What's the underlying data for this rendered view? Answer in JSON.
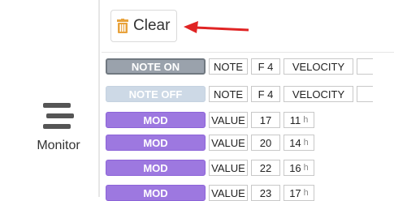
{
  "sidebar": {
    "monitor_label": "Monitor",
    "icon": "hamburger-icon"
  },
  "toolbar": {
    "clear_label": "Clear",
    "clear_icon": "trash-icon"
  },
  "colors": {
    "note_on": "#9aa2ac",
    "note_off": "#cdd9e6",
    "mod": "#9d78e0",
    "arrow": "#e02424",
    "trash": "#e8a23b"
  },
  "rows": [
    {
      "type": "NOTE ON",
      "key": "NOTE",
      "v1": "F 4",
      "key2": "VELOCITY"
    },
    {
      "type": "NOTE OFF",
      "key": "NOTE",
      "v1": "F 4",
      "key2": "VELOCITY"
    },
    {
      "type": "MOD",
      "key": "VALUE",
      "v1": "17",
      "v2": "11",
      "unit": "h"
    },
    {
      "type": "MOD",
      "key": "VALUE",
      "v1": "20",
      "v2": "14",
      "unit": "h"
    },
    {
      "type": "MOD",
      "key": "VALUE",
      "v1": "22",
      "v2": "16",
      "unit": "h"
    },
    {
      "type": "MOD",
      "key": "VALUE",
      "v1": "23",
      "v2": "17",
      "unit": "h"
    }
  ]
}
